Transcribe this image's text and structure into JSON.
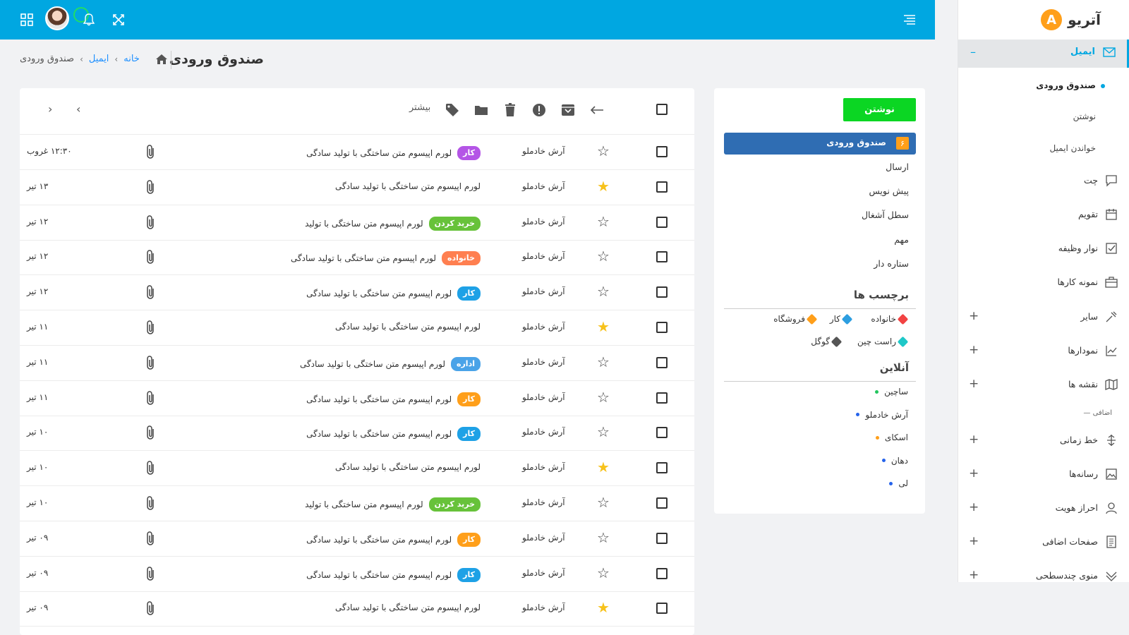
{
  "app": {
    "logo_letter": "A",
    "logo_text": "آتریو"
  },
  "colors": {
    "primary": "#00a7e1",
    "compose": "#0bd623",
    "inbox_active": "#2f6db3",
    "orange": "#ff9f1a"
  },
  "sidebar": {
    "active": {
      "label": "ایمیل",
      "icon": "mail-icon"
    },
    "sub_items": [
      "صندوق ورودی",
      "نوشتن",
      "خواندن ایمیل"
    ],
    "items": [
      {
        "label": "چت",
        "icon": "chat-icon",
        "expand": ""
      },
      {
        "label": "تقویم",
        "icon": "calendar-icon",
        "expand": ""
      },
      {
        "label": "نوار وظیفه",
        "icon": "task-icon",
        "expand": ""
      },
      {
        "label": "نمونه کارها",
        "icon": "portfolio-icon",
        "expand": ""
      },
      {
        "label": "سایر",
        "icon": "misc-icon",
        "expand": "+"
      },
      {
        "label": "نمودارها",
        "icon": "chart-icon",
        "expand": "+"
      },
      {
        "label": "نقشه ها",
        "icon": "map-icon",
        "expand": "+"
      }
    ],
    "section_label": "اضافی",
    "items2": [
      {
        "label": "خط زمانی",
        "icon": "timeline-icon",
        "expand": "+"
      },
      {
        "label": "رسانه‌ها",
        "icon": "media-icon",
        "expand": "+"
      },
      {
        "label": "احراز هویت",
        "icon": "user-icon",
        "expand": "+"
      },
      {
        "label": "صفحات اضافی",
        "icon": "page-icon",
        "expand": "+"
      },
      {
        "label": "منوی چندسطحی",
        "icon": "multilevel-icon",
        "expand": "+"
      }
    ]
  },
  "header": {
    "title": "صندوق ورودی",
    "breadcrumb": {
      "home": "خانه",
      "email": "ایمیل",
      "current": "صندوق ورودی"
    }
  },
  "toolbar": {
    "more_label": "بیشتر"
  },
  "middle": {
    "compose_label": "نوشتن",
    "inbox_label": "صندوق ورودی",
    "inbox_count": "۶",
    "folders": [
      "ارسال",
      "پیش نویس",
      "سطل آشغال",
      "مهم",
      "ستاره دار"
    ],
    "labels_heading": "برچسب ها",
    "tags": [
      {
        "name": "خانواده",
        "color": "#f24343"
      },
      {
        "name": "کار",
        "color": "#2d9ee0"
      },
      {
        "name": "فروشگاه",
        "color": "#ff9f1a"
      },
      {
        "name": "راست چین",
        "color": "#1ec8c8"
      },
      {
        "name": "گوگل",
        "color": "#555555"
      }
    ],
    "online_heading": "آنلاین",
    "online": [
      {
        "name": "ساچین",
        "color": "#22c55e"
      },
      {
        "name": "آرش خادملو",
        "color": "#2563eb"
      },
      {
        "name": "اسکای",
        "color": "#ff9f1a"
      },
      {
        "name": "دهان",
        "color": "#2563eb"
      },
      {
        "name": "لی",
        "color": "#2563eb"
      }
    ]
  },
  "emails": [
    {
      "sender": "آرش خادملو",
      "badge": "کار",
      "badge_color": "#b455e6",
      "subject": "لورم اپیسوم متن ساختگی با تولید سادگی",
      "date": "۱۲:۳۰ غروب",
      "starred": false
    },
    {
      "sender": "آرش خادملو",
      "badge": "",
      "badge_color": "",
      "subject": "لورم اپیسوم متن ساختگی با تولید سادگی",
      "date": "۱۳ تیر",
      "starred": true
    },
    {
      "sender": "آرش خادملو",
      "badge": "خرید کردن",
      "badge_color": "#67c23a",
      "subject": "لورم اپیسوم متن ساختگی با تولید",
      "date": "۱۲ تیر",
      "starred": false
    },
    {
      "sender": "آرش خادملو",
      "badge": "خانواده",
      "badge_color": "#ff7f50",
      "subject": "لورم اپیسوم متن ساختگی با تولید سادگی",
      "date": "۱۲ تیر",
      "starred": false
    },
    {
      "sender": "آرش خادملو",
      "badge": "کار",
      "badge_color": "#1ea1e6",
      "subject": "لورم اپیسوم متن ساختگی با تولید سادگی",
      "date": "۱۲ تیر",
      "starred": false
    },
    {
      "sender": "آرش خادملو",
      "badge": "",
      "badge_color": "",
      "subject": "لورم اپیسوم متن ساختگی با تولید سادگی",
      "date": "۱۱ تیر",
      "starred": true
    },
    {
      "sender": "آرش خادملو",
      "badge": "اداره",
      "badge_color": "#4aa3e8",
      "subject": "لورم اپیسوم متن ساختگی با تولید سادگی",
      "date": "۱۱ تیر",
      "starred": false
    },
    {
      "sender": "آرش خادملو",
      "badge": "کار",
      "badge_color": "#ff9f1a",
      "subject": "لورم اپیسوم متن ساختگی با تولید سادگی",
      "date": "۱۱ تیر",
      "starred": false
    },
    {
      "sender": "آرش خادملو",
      "badge": "کار",
      "badge_color": "#1ea1e6",
      "subject": "لورم اپیسوم متن ساختگی با تولید سادگی",
      "date": "۱۰ تیر",
      "starred": false
    },
    {
      "sender": "آرش خادملو",
      "badge": "",
      "badge_color": "",
      "subject": "لورم اپیسوم متن ساختگی با تولید سادگی",
      "date": "۱۰ تیر",
      "starred": true
    },
    {
      "sender": "آرش خادملو",
      "badge": "خرید کردن",
      "badge_color": "#67c23a",
      "subject": "لورم اپیسوم متن ساختگی با تولید",
      "date": "۱۰ تیر",
      "starred": false
    },
    {
      "sender": "آرش خادملو",
      "badge": "کار",
      "badge_color": "#ff9f1a",
      "subject": "لورم اپیسوم متن ساختگی با تولید سادگی",
      "date": "۰۹ تیر",
      "starred": false
    },
    {
      "sender": "آرش خادملو",
      "badge": "کار",
      "badge_color": "#1ea1e6",
      "subject": "لورم اپیسوم متن ساختگی با تولید سادگی",
      "date": "۰۹ تیر",
      "starred": false
    },
    {
      "sender": "آرش خادملو",
      "badge": "",
      "badge_color": "",
      "subject": "لورم اپیسوم متن ساختگی با تولید سادگی",
      "date": "۰۹ تیر",
      "starred": true
    }
  ]
}
